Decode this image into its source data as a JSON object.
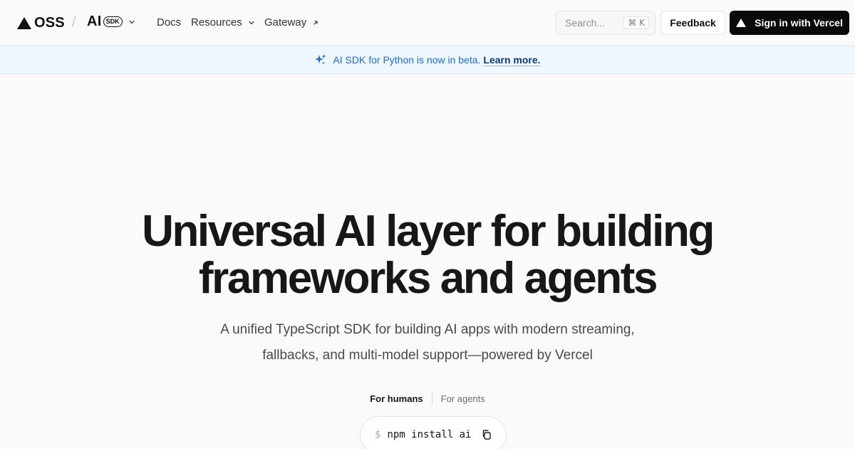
{
  "header": {
    "brand": "OSS",
    "separator": "/",
    "product_name": "AI",
    "product_badge": "SDK",
    "nav": {
      "docs": "Docs",
      "resources": "Resources",
      "gateway": "Gateway"
    },
    "search": {
      "placeholder": "Search...",
      "shortcut": "⌘ K"
    },
    "feedback_label": "Feedback",
    "signin_label": "Sign in with Vercel"
  },
  "banner": {
    "message": "AI SDK for Python is now in beta.",
    "link_label": "Learn more.",
    "accent": "#1a6dcc"
  },
  "hero": {
    "title_line1": "Universal AI layer for building",
    "title_line2": "frameworks and agents",
    "subtitle_line1": "A unified TypeScript SDK for building AI apps with modern streaming,",
    "subtitle_line2": "fallbacks, and multi-model support—powered by Vercel",
    "tabs": {
      "humans": "For humans",
      "agents": "For agents"
    },
    "install": {
      "prompt": "$",
      "command": "npm install ai"
    }
  },
  "icons": {
    "brand": "vercel-triangle-icon",
    "product_menu": "chevron-down-icon",
    "resources_menu": "chevron-down-icon",
    "gateway_external": "arrow-up-right-icon",
    "signin": "vercel-triangle-icon",
    "banner": "sparkle-icon",
    "copy": "copy-icon"
  }
}
